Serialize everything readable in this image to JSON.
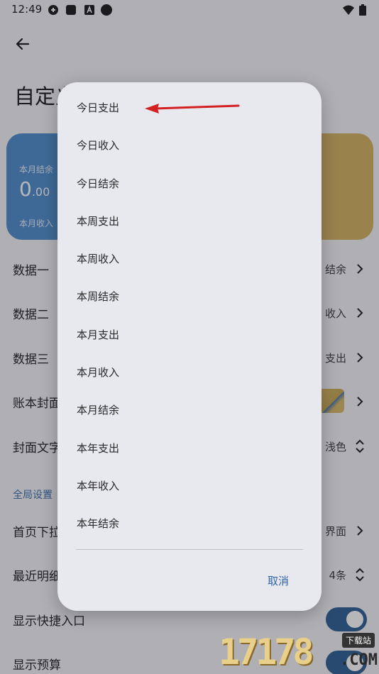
{
  "status_bar": {
    "time": "12:49"
  },
  "page": {
    "title": "自定义",
    "card": {
      "label_top": "本月结余",
      "amount_int": "0",
      "amount_dec": ".00",
      "label_bottom": "本月收入"
    },
    "rows": [
      {
        "label": "数据一",
        "value": "结余"
      },
      {
        "label": "数据二",
        "value": "收入"
      },
      {
        "label": "数据三",
        "value": "支出"
      },
      {
        "label": "账本封面",
        "value": ""
      },
      {
        "label": "封面文字",
        "value": "浅色"
      }
    ],
    "section_title": "全局设置",
    "global_rows": [
      {
        "label": "首页下拉",
        "value": "界面"
      },
      {
        "label": "最近明细",
        "value": "4条"
      },
      {
        "label": "显示快捷入口"
      },
      {
        "label": "显示预算"
      }
    ]
  },
  "dialog": {
    "options": [
      "今日支出",
      "今日收入",
      "今日结余",
      "本周支出",
      "本周收入",
      "本周结余",
      "本月支出",
      "本月收入",
      "本月结余",
      "本年支出",
      "本年收入",
      "本年结余"
    ],
    "cancel_label": "取消"
  },
  "watermark": {
    "digits": "17178",
    "badge": "下载站",
    "suffix": ".COM"
  },
  "colors": {
    "accent": "#2f62a6",
    "card_blue": "#4d8dcc",
    "card_gold": "#d4b25f",
    "toggle_on": "#2f5f92",
    "arrow_red": "#d32020"
  }
}
